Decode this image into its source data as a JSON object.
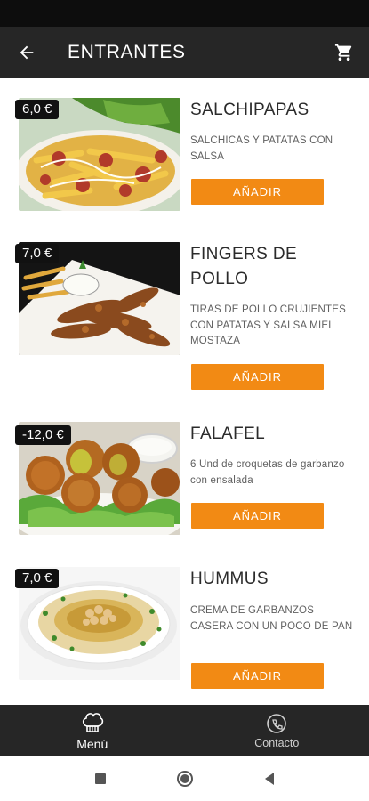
{
  "header": {
    "title": "ENTRANTES",
    "back_icon": "arrow-left-icon",
    "cart_icon": "cart-icon"
  },
  "products": [
    {
      "price": "6,0 €",
      "name": "SALCHIPAPAS",
      "description": "SALCHICAS Y PATATAS CON SALSA",
      "button": "AÑADIR"
    },
    {
      "price": "7,0 €",
      "name": "FINGERS DE POLLO",
      "description": "TIRAS DE POLLO CRUJIENTES CON PATATAS Y SALSA MIEL MOSTAZA",
      "button": "AÑADIR"
    },
    {
      "price": "-12,0 €",
      "name": "FALAFEL",
      "description": "6 Und de croquetas de garbanzo con ensalada",
      "button": "AÑADIR"
    },
    {
      "price": "7,0 €",
      "name": "HUMMUS",
      "description": "CREMA DE GARBANZOS CASERA CON UN POCO DE PAN",
      "button": "AÑADIR"
    }
  ],
  "bottom_nav": [
    {
      "label": "Menú",
      "icon": "chef-hat-icon",
      "active": true
    },
    {
      "label": "Contacto",
      "icon": "contact-icon",
      "active": false
    }
  ],
  "colors": {
    "accent": "#f28a14",
    "bar": "#262626",
    "price_tag": "#111111"
  }
}
